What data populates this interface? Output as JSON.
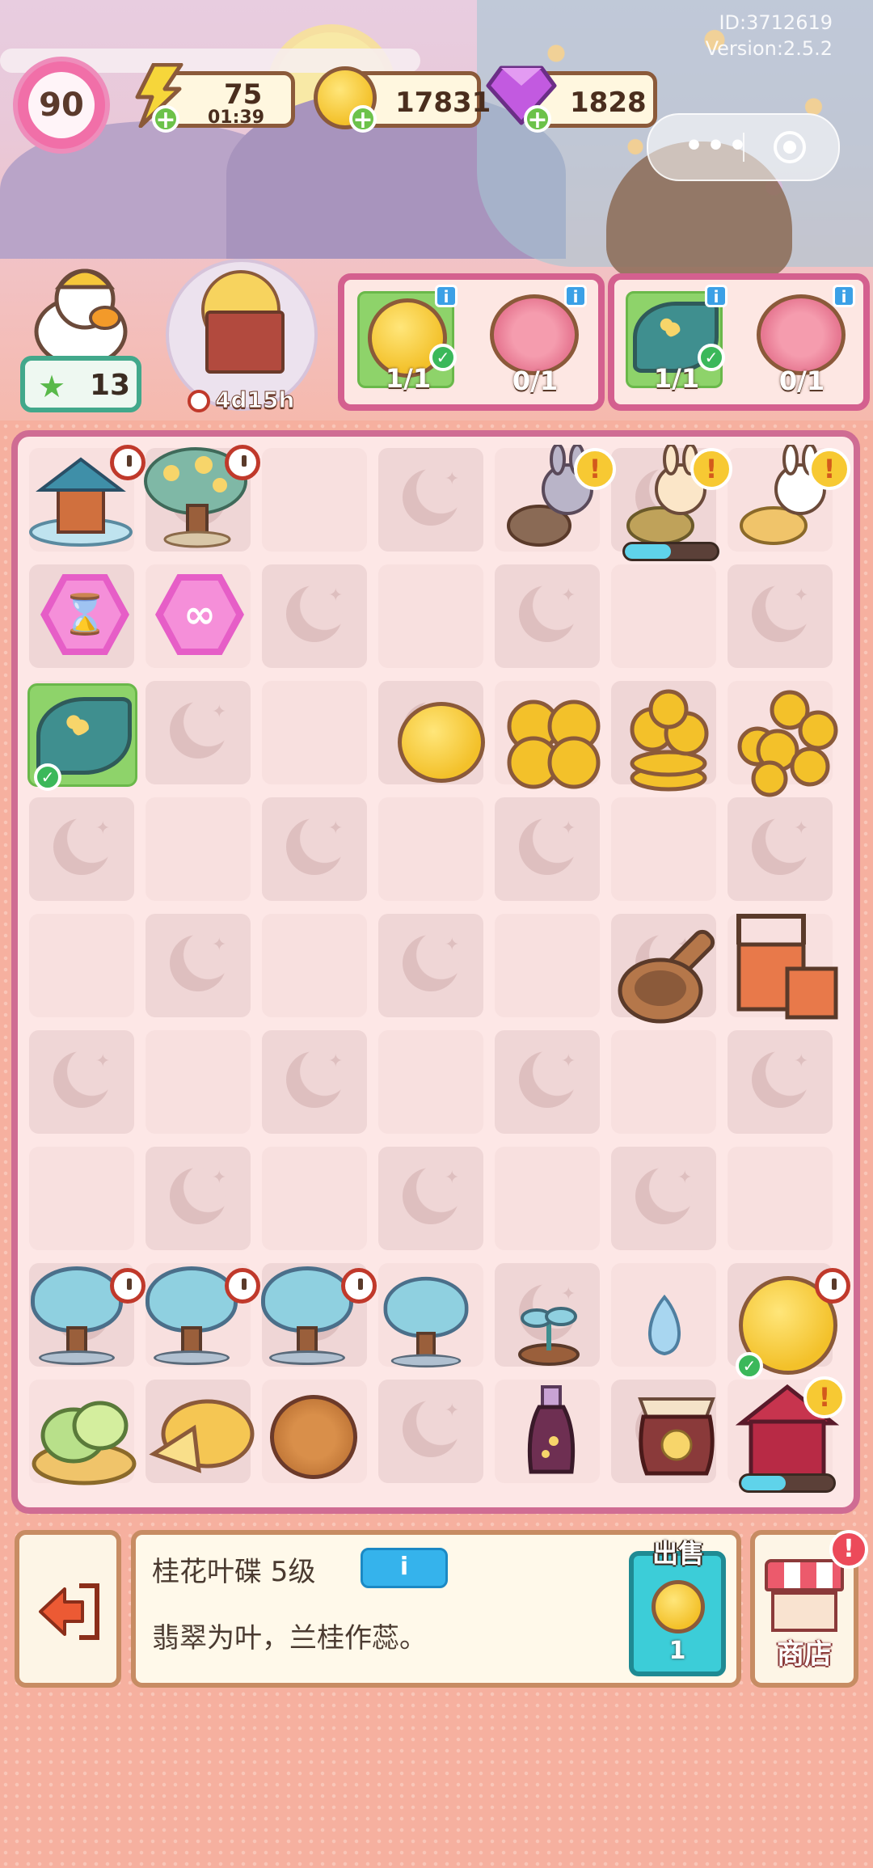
{
  "header": {
    "id_text": "ID:3712619",
    "version_text": "Version:2.5.2",
    "level": "90",
    "energy": {
      "value": "75",
      "timer": "01:39"
    },
    "coins": {
      "value": "17831"
    },
    "gems": {
      "value": "1828"
    }
  },
  "event": {
    "stars": "13",
    "timer": "4d15h"
  },
  "orders": [
    {
      "slots": [
        {
          "count": "1/1",
          "done": true
        },
        {
          "count": "0/1",
          "done": false
        }
      ]
    },
    {
      "slots": [
        {
          "count": "1/1",
          "done": true
        },
        {
          "count": "0/1",
          "done": false
        }
      ]
    }
  ],
  "board": {
    "hexes": [
      {
        "glyph": "⌛"
      },
      {
        "glyph": "∞"
      }
    ]
  },
  "selected_item": {
    "name": "桂花叶碟 5级",
    "info_icon": "i",
    "description": "翡翠为叶，兰桂作蕊。",
    "sell_label": "出售",
    "sell_value": "1"
  },
  "shop": {
    "label": "商店",
    "badge": "!"
  },
  "colors": {
    "board_border": "#cf6c93",
    "energy_bar": "#5fd3ea"
  }
}
